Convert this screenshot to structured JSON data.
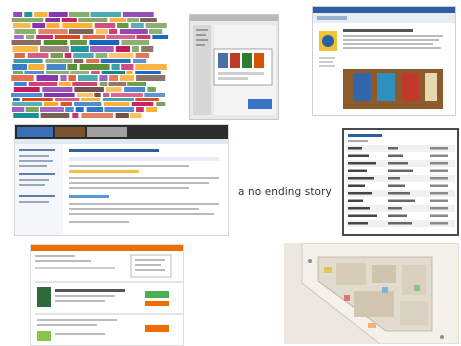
{
  "caption": "a no ending story",
  "colors": {
    "background": "#ffffff",
    "caption_text": "#333333",
    "word_cloud_palette": [
      "#c2185b",
      "#7b1fa2",
      "#d84315",
      "#558b2f",
      "#1565c0",
      "#6d4c41",
      "#f9a825",
      "#00838f"
    ],
    "site_header_blue": "#2a5fa0",
    "tracker_orange": "#ef6c00",
    "map_base": "#ece8e0"
  },
  "thumbnails": [
    {
      "name": "word-cloud"
    },
    {
      "name": "cover-gallery-window"
    },
    {
      "name": "library-site-page"
    },
    {
      "name": "tracker-web-page"
    },
    {
      "name": "data-table-window"
    },
    {
      "name": "orange-site-page"
    },
    {
      "name": "floor-plan-map"
    }
  ]
}
